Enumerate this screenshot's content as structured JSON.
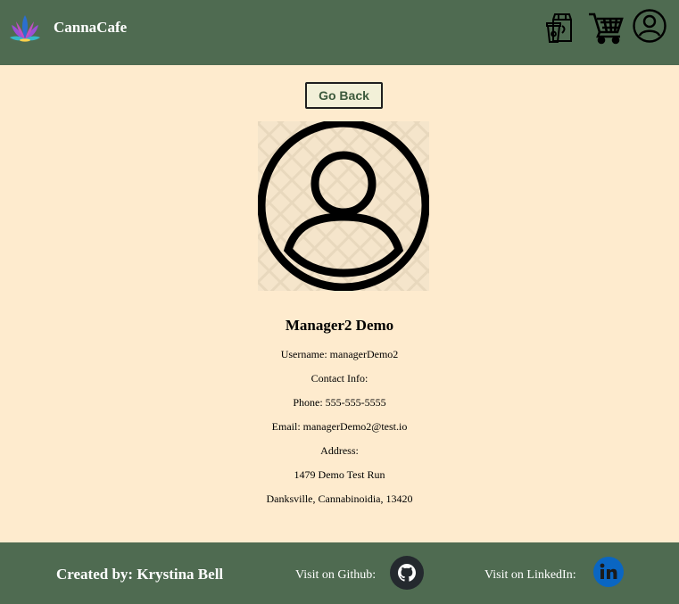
{
  "header": {
    "brand": "CannaCafe",
    "logo_icon": "lotus-icon",
    "icons": [
      "menu-bag-icon",
      "shopping-cart-icon",
      "user-account-icon"
    ]
  },
  "main": {
    "go_back_label": "Go Back",
    "avatar_icon": "user-avatar-icon",
    "profile": {
      "name": "Manager2 Demo",
      "username": "Username: managerDemo2",
      "contact_heading": "Contact Info:",
      "phone": "Phone: 555-555-5555",
      "email": "Email: managerDemo2@test.io",
      "address_heading": "Address:",
      "address_line1": "1479 Demo Test Run",
      "address_line2": "Danksville, Cannabinoidia, 13420"
    }
  },
  "footer": {
    "created_by": "Created by: Krystina Bell",
    "github_label": "Visit on Github:",
    "linkedin_label": "Visit on LinkedIn:",
    "github_icon": "github-icon",
    "linkedin_icon": "linkedin-icon"
  },
  "colors": {
    "header_bg": "#4f6b51",
    "page_bg": "#feebce",
    "footer_bg": "#4f6b51",
    "button_text": "#3c5a3c",
    "linkedin_blue": "#0a66c2"
  }
}
